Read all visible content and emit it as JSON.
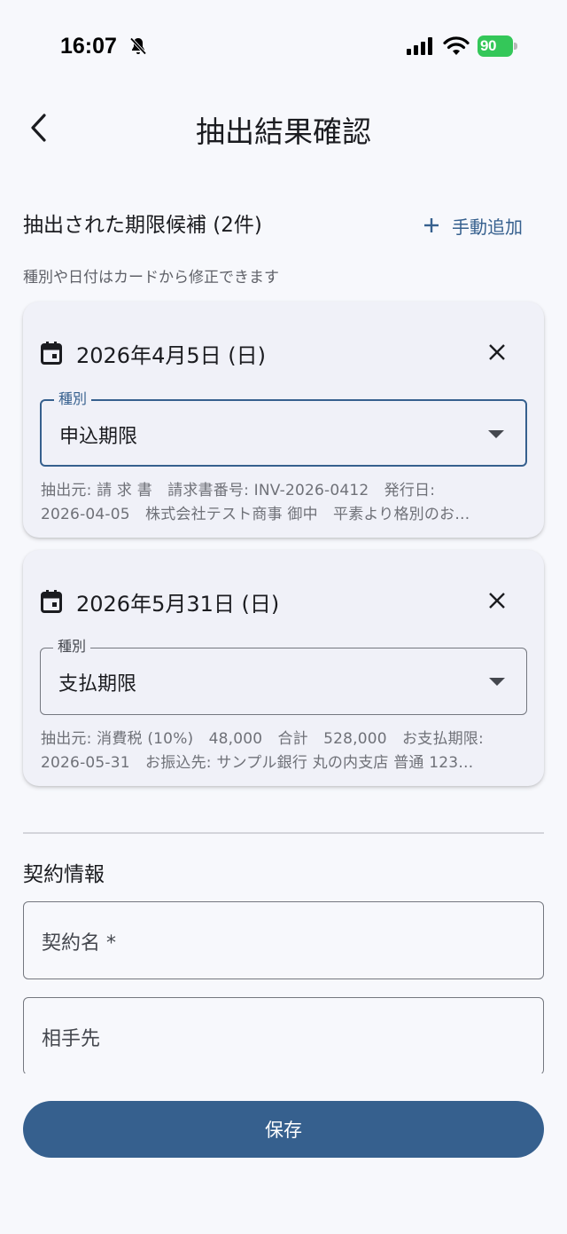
{
  "status_bar": {
    "time": "16:07",
    "battery": "90"
  },
  "app_bar": {
    "title": "抽出結果確認"
  },
  "section": {
    "title": "抽出された期限候補 (2件)",
    "manual_add_label": "手動追加",
    "hint": "種別や日付はカードから修正できます"
  },
  "candidates": [
    {
      "date": "2026年4月5日 (日)",
      "type_label": "種別",
      "type_value": "申込期限",
      "source_line1": "抽出元: 請 求 書　請求書番号: INV-2026-0412　発行日:",
      "source_line2": "2026-04-05　株式会社テスト商事 御中　平素より格別のお…"
    },
    {
      "date": "2026年5月31日 (日)",
      "type_label": "種別",
      "type_value": "支払期限",
      "source_line1": "抽出元: 消費税 (10%)　48,000　合計　528,000　お支払期限:",
      "source_line2": "2026-05-31　お振込先: サンプル銀行 丸の内支店 普通 123…"
    }
  ],
  "contract": {
    "title": "契約情報",
    "name_label": "契約名 *",
    "counterparty_label": "相手先"
  },
  "save_label": "保存",
  "colors": {
    "primary": "#36608e",
    "background": "#f7f8fc",
    "card": "#f0f1f8",
    "battery": "#34c759"
  },
  "icons": [
    "bell-off-icon",
    "signal-icon",
    "wifi-icon",
    "back-arrow-icon",
    "plus-icon",
    "calendar-icon",
    "close-icon",
    "dropdown-arrow-icon"
  ]
}
